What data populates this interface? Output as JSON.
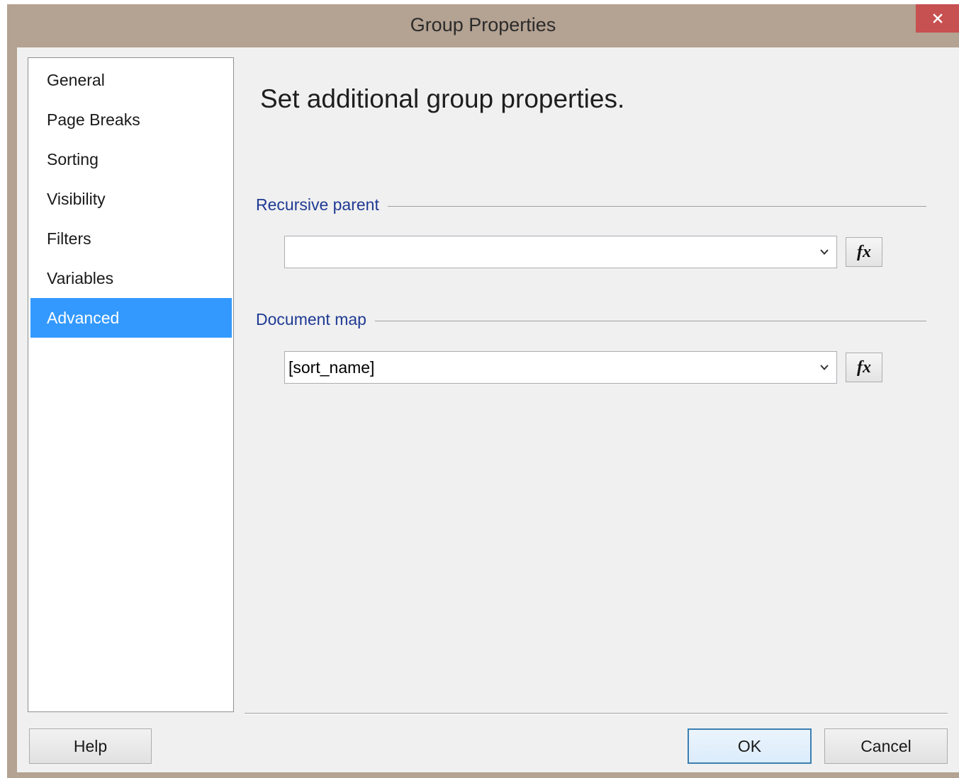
{
  "window": {
    "title": "Group Properties"
  },
  "nav": {
    "items": [
      {
        "label": "General",
        "selected": false
      },
      {
        "label": "Page Breaks",
        "selected": false
      },
      {
        "label": "Sorting",
        "selected": false
      },
      {
        "label": "Visibility",
        "selected": false
      },
      {
        "label": "Filters",
        "selected": false
      },
      {
        "label": "Variables",
        "selected": false
      },
      {
        "label": "Advanced",
        "selected": true
      }
    ]
  },
  "main": {
    "heading": "Set additional group properties.",
    "recursive_parent": {
      "label": "Recursive parent",
      "value": ""
    },
    "document_map": {
      "label": "Document map",
      "value": "[sort_name]"
    },
    "fx_label": "fx"
  },
  "footer": {
    "help_label": "Help",
    "ok_label": "OK",
    "cancel_label": "Cancel"
  },
  "colors": {
    "title_bar": "#b4a292",
    "close_button": "#c75050",
    "selection": "#3399ff",
    "section_label": "#1f3a93",
    "client_bg": "#f0f0f0"
  }
}
